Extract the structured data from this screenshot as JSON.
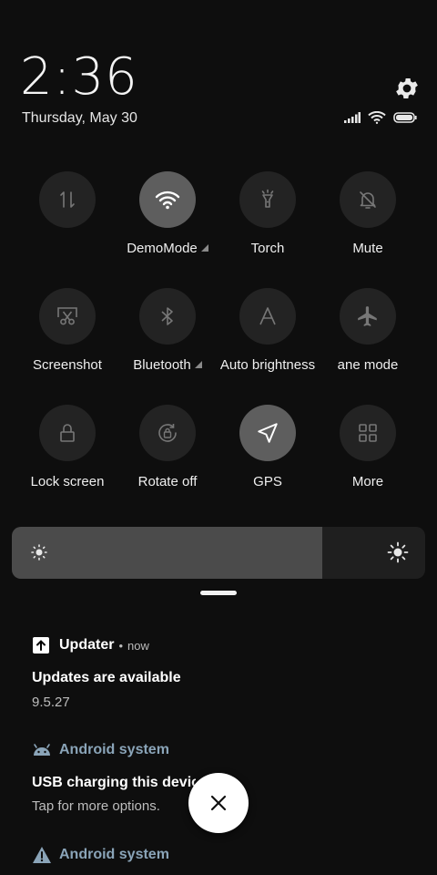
{
  "status": {
    "time": "2:36",
    "date": "Thursday, May 30"
  },
  "tiles": [
    {
      "id": "data",
      "label": "",
      "active": false
    },
    {
      "id": "wifi",
      "label": "DemoMode",
      "active": true,
      "dropdown": true
    },
    {
      "id": "torch",
      "label": "Torch",
      "active": false
    },
    {
      "id": "mute",
      "label": "Mute",
      "active": false
    },
    {
      "id": "screenshot",
      "label": "Screenshot",
      "active": false
    },
    {
      "id": "bluetooth",
      "label": "Bluetooth",
      "active": false,
      "dropdown": true
    },
    {
      "id": "auto-brightness",
      "label": "Auto brightness",
      "active": false
    },
    {
      "id": "airplane",
      "label": "ane mode",
      "active": false
    },
    {
      "id": "lock",
      "label": "Lock screen",
      "active": false
    },
    {
      "id": "rotate",
      "label": "Rotate off",
      "active": false
    },
    {
      "id": "gps",
      "label": "GPS",
      "active": true
    },
    {
      "id": "more",
      "label": "More",
      "active": false
    }
  ],
  "brightness": {
    "level_percent": 75
  },
  "notifications": [
    {
      "app": "Updater",
      "time": "now",
      "title": "Updates are available",
      "text": "9.5.27"
    },
    {
      "app": "Android system",
      "title": "USB charging this device",
      "text": "Tap for more options."
    },
    {
      "app": "Android system"
    }
  ],
  "colors": {
    "background": "#0e0e0e",
    "tile": "#232323",
    "tile_active": "#5e5e5e",
    "system_app": "#8aa4b8"
  }
}
